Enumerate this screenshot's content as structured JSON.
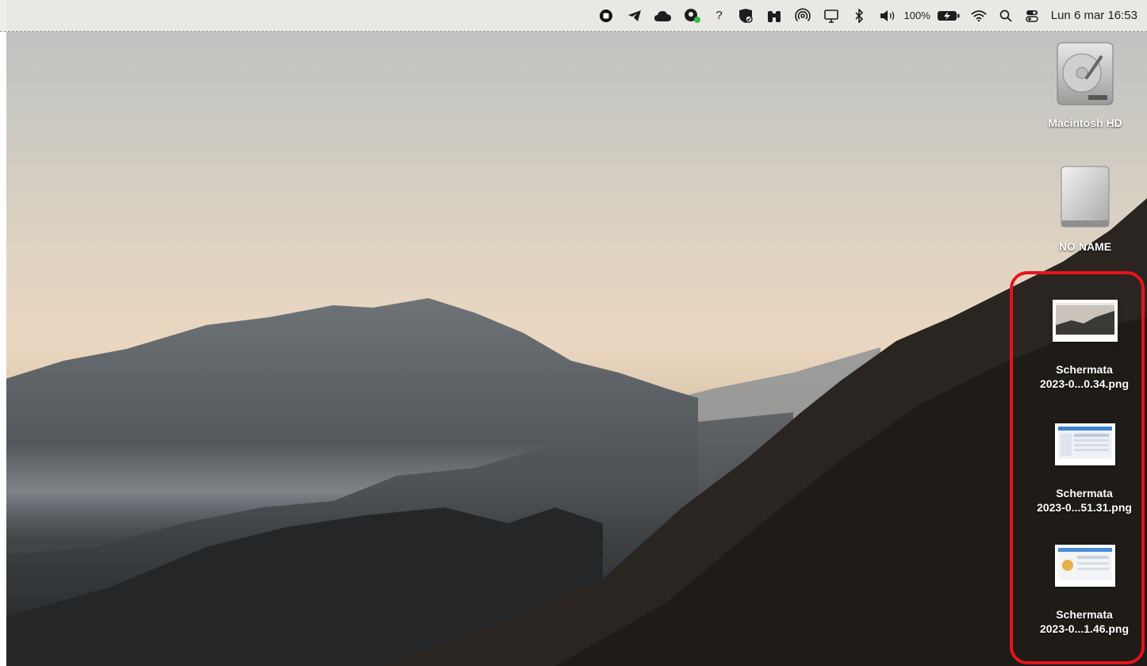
{
  "menubar": {
    "status_icons": [
      {
        "name": "stop-record-icon"
      },
      {
        "name": "telegram-icon"
      },
      {
        "name": "cloud-icon"
      },
      {
        "name": "vpn-status-icon"
      },
      {
        "name": "help-icon"
      },
      {
        "name": "security-shield-icon"
      },
      {
        "name": "binoculars-icon"
      },
      {
        "name": "airdrop-icon"
      },
      {
        "name": "display-icon"
      },
      {
        "name": "bluetooth-icon"
      },
      {
        "name": "volume-icon"
      }
    ],
    "battery_percent": "100%",
    "clock": "Lun 6 mar  16:53"
  },
  "desktop_icons": [
    {
      "kind": "drive",
      "label": "Macintosh HD"
    },
    {
      "kind": "external",
      "label": "NO NAME"
    },
    {
      "kind": "screenshot",
      "label_line1": "Schermata",
      "label_line2": "2023-0...0.34.png"
    },
    {
      "kind": "screenshot",
      "label_line1": "Schermata",
      "label_line2": "2023-0...51.31.png"
    },
    {
      "kind": "screenshot",
      "label_line1": "Schermata",
      "label_line2": "2023-0...1.46.png"
    }
  ],
  "colors": {
    "selection": "#e8121c"
  }
}
